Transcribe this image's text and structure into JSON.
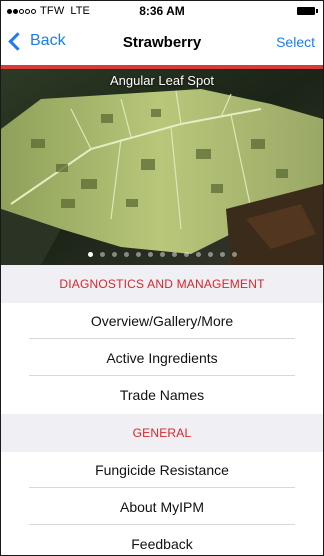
{
  "status_bar": {
    "carrier": "TFW",
    "network": "LTE",
    "time": "8:36 AM"
  },
  "nav": {
    "back_label": "Back",
    "title": "Strawberry",
    "select_label": "Select"
  },
  "hero": {
    "caption": "Angular Leaf Spot",
    "slide_count": 13,
    "active_slide": 1
  },
  "sections": [
    {
      "header": "DIAGNOSTICS AND MANAGEMENT",
      "items": [
        "Overview/Gallery/More",
        "Active Ingredients",
        "Trade Names"
      ]
    },
    {
      "header": "GENERAL",
      "items": [
        "Fungicide Resistance",
        "About MyIPM",
        "Feedback"
      ]
    }
  ],
  "colors": {
    "accent_blue": "#1b7cf5",
    "accent_red": "#d9262a",
    "section_bg": "#efeff4"
  }
}
